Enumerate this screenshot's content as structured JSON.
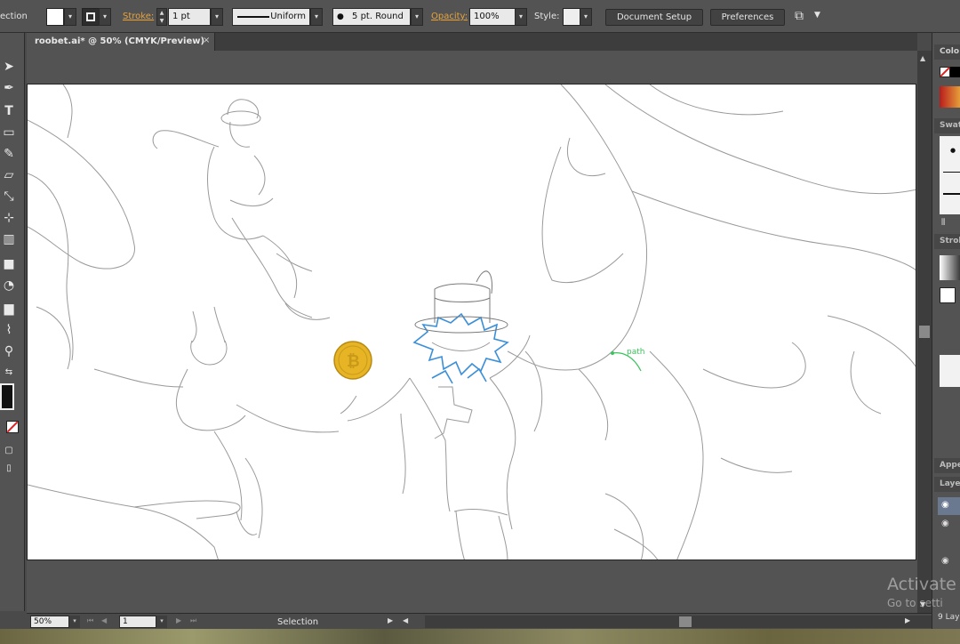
{
  "controlbar": {
    "tool_mode": "ection",
    "stroke_label": "Stroke:",
    "stroke_weight": "1 pt",
    "stroke_profile": "Uniform",
    "brush": "5 pt. Round",
    "opacity_label": "Opacity:",
    "opacity_value": "100%",
    "style_label": "Style:",
    "document_setup": "Document Setup",
    "preferences": "Preferences"
  },
  "tab": {
    "title": "roobet.ai* @ 50% (CMYK/Preview)",
    "close": "×"
  },
  "tools": [
    "selection-tool",
    "direct-selection-tool",
    "pen-tool",
    "type-tool",
    "rectangle-tool",
    "pencil-tool",
    "eraser-tool",
    "scale-tool",
    "free-transform-tool",
    "symbol-sprayer-tool",
    "gradient-tool",
    "shape-builder-tool",
    "graph-tool",
    "eyedropper-tool",
    "zoom-tool"
  ],
  "artboard": {
    "annotation_label": "path"
  },
  "statusbar": {
    "zoom": "50%",
    "artboard_number": "1",
    "status_text": "Selection"
  },
  "rightpanel": {
    "color": "Colo",
    "swatches": "Swat",
    "stroke": "Strok",
    "appearance": "Appe",
    "layers": "Laye",
    "layer_count": "9 Lay"
  },
  "watermark": {
    "line1": "Activate V",
    "line2": "Go to setti"
  },
  "colors": {
    "accent_link": "#e8a33a",
    "coin": "#e6b424",
    "highlight_blue": "#3b8fd9",
    "path_green": "#38c45a"
  }
}
